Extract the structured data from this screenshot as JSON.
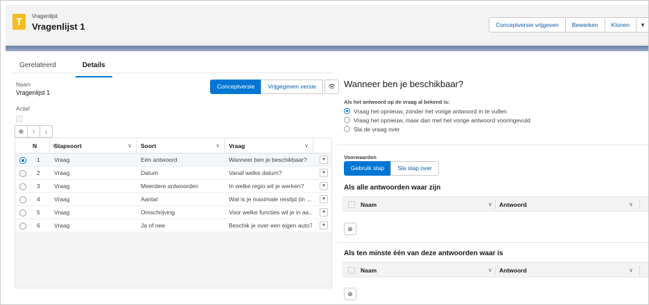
{
  "header": {
    "object_type": "Vragenlijst",
    "title": "Vragenlijst 1",
    "app_icon_glyph": "T",
    "actions": [
      "Conceptversie vrijgeven",
      "Bewerken",
      "Klonen"
    ],
    "more_icon": "▼"
  },
  "tabs": [
    "Gerelateerd",
    "Details"
  ],
  "details": {
    "name_label": "Naam",
    "name_value": "Vragenlijst 1",
    "active_label": "Actief"
  },
  "version_toggle": {
    "concept": "Conceptversie",
    "released": "Vrijgegeven versie",
    "eye_icon": "👁"
  },
  "toolbar": {
    "add": "⊕",
    "up": "↑",
    "down": "↓"
  },
  "grid": {
    "columns": [
      "N",
      "Stapsoort",
      "Soort",
      "Vraag"
    ],
    "rows": [
      {
        "n": "1",
        "stapsoort": "Vraag",
        "soort": "Eén antwoord",
        "vraag": "Wanneer ben je beschikbaar?"
      },
      {
        "n": "2",
        "stapsoort": "Vraag",
        "soort": "Datum",
        "vraag": "Vanaf welke datum?"
      },
      {
        "n": "3",
        "stapsoort": "Vraag",
        "soort": "Meerdere antwoorden",
        "vraag": "In welke regio wil je werken?"
      },
      {
        "n": "4",
        "stapsoort": "Vraag",
        "soort": "Aantal",
        "vraag": "Wat is je maximale reistijd (in ..."
      },
      {
        "n": "5",
        "stapsoort": "Vraag",
        "soort": "Omschrijving",
        "vraag": "Voor welke functies wil je in aa..."
      },
      {
        "n": "6",
        "stapsoort": "Vraag",
        "soort": "Ja of nee",
        "vraag": "Beschik je over een eigen auto?"
      }
    ],
    "selected_row": 0
  },
  "question": {
    "title": "Wanneer ben je beschikbaar?",
    "known_label": "Als het antwoord op de vraag al bekend is:",
    "options": [
      "Vraag het opnieuw, zonder het vorige antwoord in te vullen",
      "Vraag het opnieuw, maar dan met het vorige antwoord vooringevuld",
      "Sla de vraag over"
    ],
    "selected_option": 0
  },
  "conditions": {
    "label": "Voorwaarden",
    "use_step": "Gebruik stap",
    "skip_step": "Sla stap over",
    "all_true_heading": "Als alle antwoorden waar zijn",
    "any_true_heading": "Als ten minste één van deze antwoorden waar is",
    "col_name": "Naam",
    "col_answer": "Antwoord",
    "add_icon": "⊕"
  }
}
